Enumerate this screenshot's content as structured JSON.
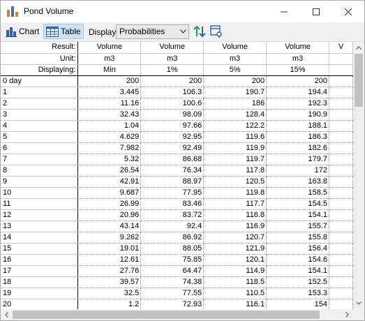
{
  "window": {
    "title": "Pond Volume"
  },
  "toolbar": {
    "chart_label": "Chart",
    "table_label": "Table",
    "display_label": "Display:",
    "display_value": "Probabilities"
  },
  "table": {
    "header_labels": [
      "Result:",
      "Unit:",
      "Displaying:"
    ],
    "result": [
      "Volume",
      "Volume",
      "Volume",
      "Volume",
      "V"
    ],
    "unit": [
      "m3",
      "m3",
      "m3",
      "m3",
      ""
    ],
    "displaying": [
      "Min",
      "1%",
      "5%",
      "15%",
      ""
    ],
    "rows": [
      {
        "label": "0 day",
        "values": [
          "200",
          "200",
          "200",
          "200"
        ]
      },
      {
        "label": "1",
        "values": [
          "3.445",
          "106.3",
          "190.7",
          "194.4"
        ]
      },
      {
        "label": "2",
        "values": [
          "11.16",
          "100.6",
          "186",
          "192.3"
        ]
      },
      {
        "label": "3",
        "values": [
          "32.43",
          "98.09",
          "128.4",
          "190.9"
        ]
      },
      {
        "label": "4",
        "values": [
          "1.04",
          "97.66",
          "122.2",
          "188.1"
        ]
      },
      {
        "label": "5",
        "values": [
          "4.629",
          "92.95",
          "119.6",
          "186.3"
        ]
      },
      {
        "label": "6",
        "values": [
          "7.982",
          "92.49",
          "119.9",
          "182.6"
        ]
      },
      {
        "label": "7",
        "values": [
          "5.32",
          "86.68",
          "119.7",
          "179.7"
        ]
      },
      {
        "label": "8",
        "values": [
          "26.54",
          "76.34",
          "117.8",
          "172"
        ]
      },
      {
        "label": "9",
        "values": [
          "42.91",
          "88.97",
          "120.5",
          "163.8"
        ]
      },
      {
        "label": "10",
        "values": [
          "9.687",
          "77.95",
          "119.8",
          "158.5"
        ]
      },
      {
        "label": "11",
        "values": [
          "26.99",
          "83.46",
          "117.7",
          "154.5"
        ]
      },
      {
        "label": "12",
        "values": [
          "20.96",
          "83.72",
          "116.8",
          "154.1"
        ]
      },
      {
        "label": "13",
        "values": [
          "43.14",
          "92.4",
          "116.9",
          "155.7"
        ]
      },
      {
        "label": "14",
        "values": [
          "9.262",
          "86.92",
          "120.7",
          "155.8"
        ]
      },
      {
        "label": "15",
        "values": [
          "19.01",
          "88.05",
          "121.9",
          "156.4"
        ]
      },
      {
        "label": "16",
        "values": [
          "12.61",
          "75.85",
          "120.1",
          "154.6"
        ]
      },
      {
        "label": "17",
        "values": [
          "27.76",
          "64.47",
          "114.9",
          "154.1"
        ]
      },
      {
        "label": "18",
        "values": [
          "39.57",
          "74.38",
          "118.5",
          "152.5"
        ]
      },
      {
        "label": "19",
        "values": [
          "32.5",
          "77.55",
          "110.5",
          "153.3"
        ]
      },
      {
        "label": "20",
        "values": [
          "1.2",
          "72.93",
          "116.1",
          "154"
        ]
      }
    ]
  }
}
